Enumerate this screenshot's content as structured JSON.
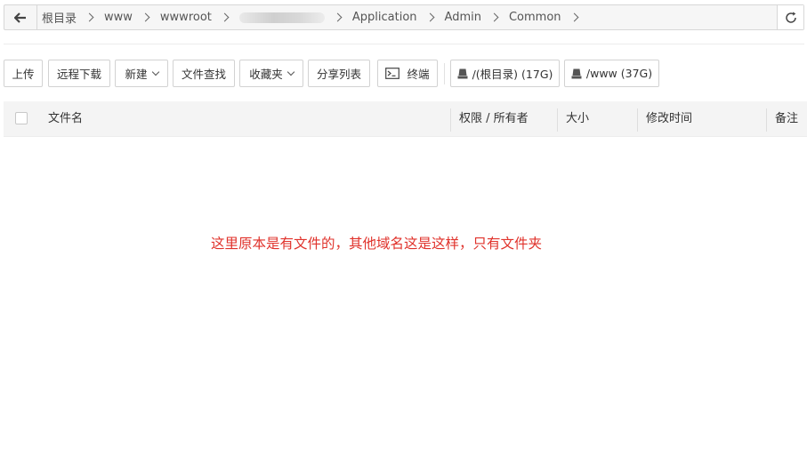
{
  "breadcrumb": {
    "items": [
      "根目录",
      "www",
      "wwwroot",
      "",
      "Application",
      "Admin",
      "Common"
    ]
  },
  "toolbar": {
    "upload": "上传",
    "remote_download": "远程下载",
    "new": "新建",
    "file_search": "文件查找",
    "favorites": "收藏夹",
    "share_list": "分享列表",
    "terminal": "终端",
    "disk_root": "/(根目录) (17G)",
    "disk_www": "/www (37G)"
  },
  "table": {
    "columns": [
      "文件名",
      "权限 / 所有者",
      "大小",
      "修改时间",
      "备注"
    ]
  },
  "annotation": {
    "text": "这里原本是有文件的，其他域名这是这样，只有文件夹",
    "color": "#e0322b"
  },
  "icons": [
    "back-arrow-icon",
    "chevron-right-icon",
    "refresh-icon",
    "chevron-down-icon",
    "terminal-icon",
    "disk-icon"
  ]
}
